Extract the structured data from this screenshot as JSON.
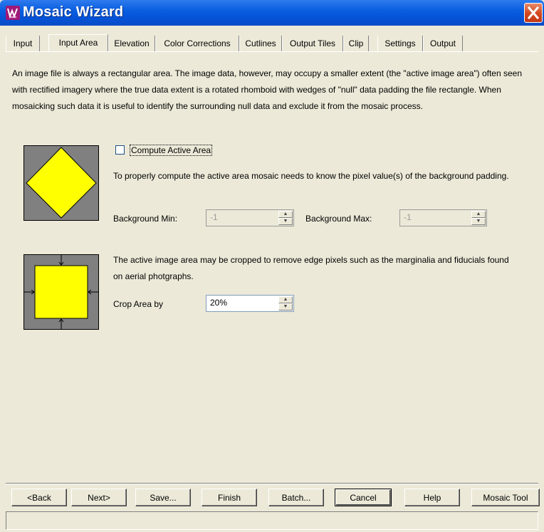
{
  "window": {
    "title": "Mosaic Wizard"
  },
  "tabs": [
    {
      "label": "Input"
    },
    {
      "label": "Input Area",
      "active": true
    },
    {
      "label": "Elevation"
    },
    {
      "label": "Color Corrections"
    },
    {
      "label": "Cutlines"
    },
    {
      "label": "Output Tiles"
    },
    {
      "label": "Clip"
    },
    {
      "label": "Settings"
    },
    {
      "label": "Output"
    }
  ],
  "intro": "An image file is always a rectangular area. The image data, however, may occupy a smaller extent (the \"active image area\") often seen with rectified imagery where the true data extent is a rotated rhomboid with wedges of \"null\" data padding the file rectangle. When mosaicking such data it is useful to identify the surrounding null data and exclude it from the mosaic process.",
  "active_area": {
    "checkbox_label": "Compute Active Area",
    "checked": false,
    "description": "To properly compute the active area mosaic needs to know the pixel value(s) of the background padding.",
    "bg_min_label": "Background Min:",
    "bg_min_value": "-1",
    "bg_max_label": "Background Max:",
    "bg_max_value": "-1"
  },
  "crop": {
    "description": "The active image area may be cropped to remove edge pixels such as the marginalia and fiducials found on aerial photgraphs.",
    "label": "Crop Area by",
    "value": "20%"
  },
  "buttons": {
    "back": "<Back",
    "next": "Next>",
    "save": "Save...",
    "finish": "Finish",
    "batch": "Batch...",
    "cancel": "Cancel",
    "help": "Help",
    "mosaic_tool": "Mosaic Tool"
  },
  "colors": {
    "title_bar": "#0A5FE0",
    "highlight_shape": "#FFFF00",
    "background_padding": "#808080",
    "window_face": "#ECE9D8"
  }
}
